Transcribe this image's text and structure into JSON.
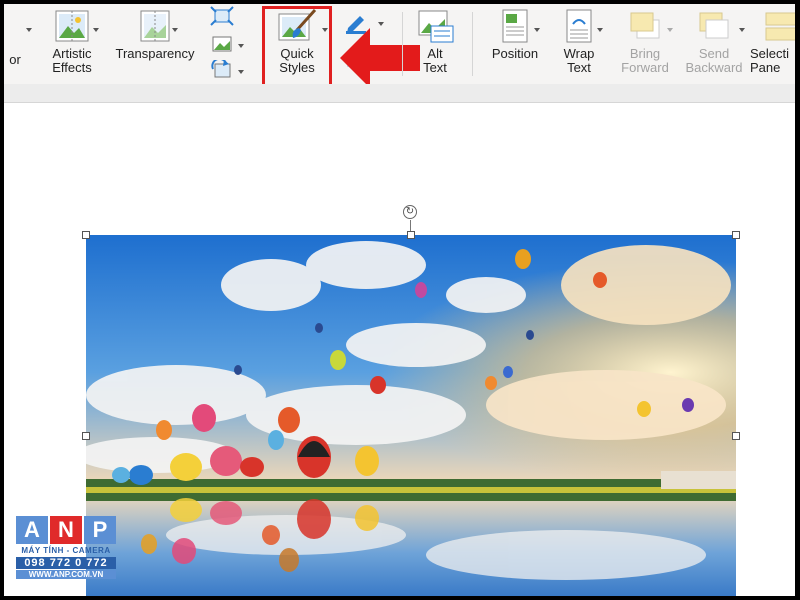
{
  "ribbon": {
    "partial_left_label": "or",
    "artistic_effects_label": "Artistic\nEffects",
    "transparency_label": "Transparency",
    "quick_styles_label": "Quick\nStyles",
    "alt_text_label": "Alt\nText",
    "position_label": "Position",
    "wrap_text_label": "Wrap\nText",
    "bring_forward_label": "Bring\nForward",
    "send_backward_label": "Send\nBackward",
    "selection_pane_label": "Selecti\nPane"
  },
  "watermark": {
    "letters": [
      "A",
      "N",
      "P"
    ],
    "tagline": "MÁY TÍNH - CAMERA",
    "phone": "098 772 0 772",
    "url": "WWW.ANP.COM.VN"
  },
  "colors": {
    "highlight": "#e02020",
    "arrow": "#e31b1b",
    "ribbon_bg": "#f5f4f3"
  }
}
